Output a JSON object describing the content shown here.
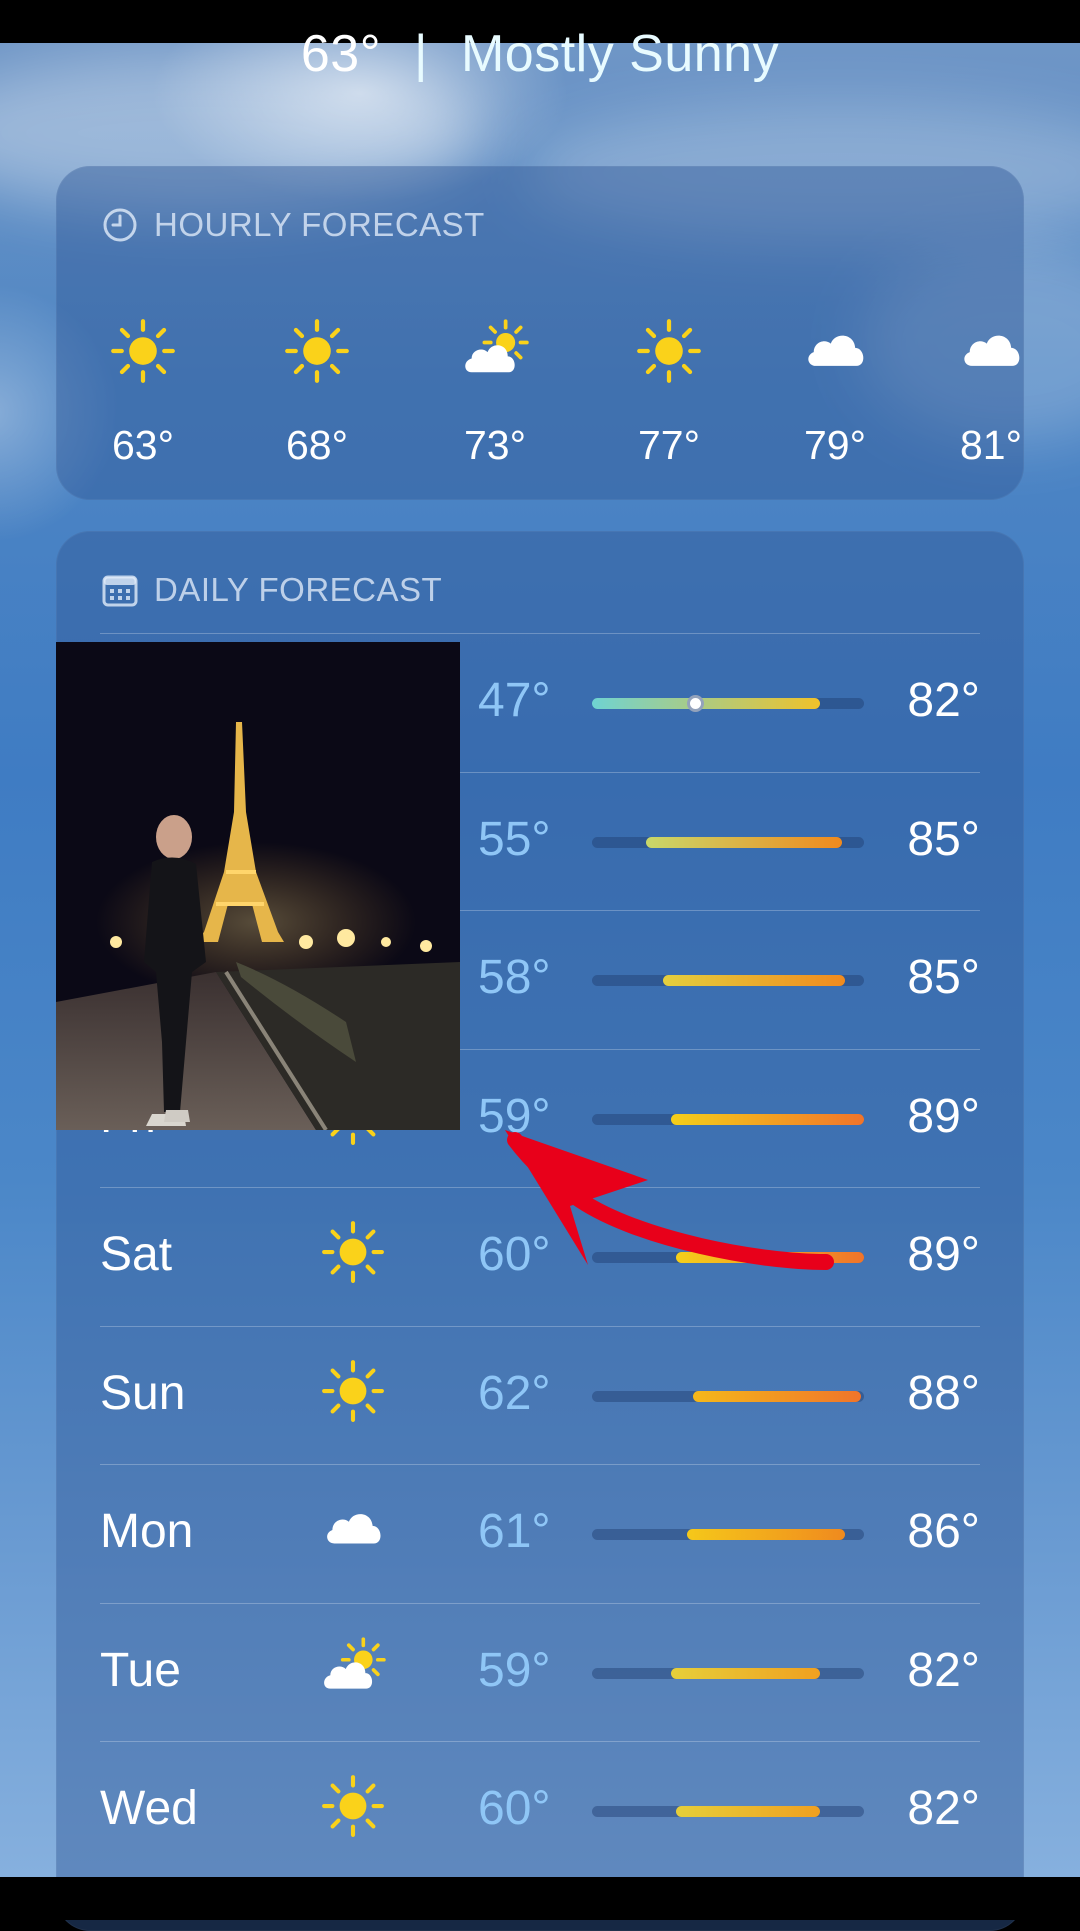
{
  "current": {
    "temp": "63°",
    "separator": "|",
    "condition": "Mostly Sunny"
  },
  "hourly": {
    "title": "HOURLY FORECAST",
    "items": [
      {
        "icon": "sun-icon",
        "temp": "63°"
      },
      {
        "icon": "sun-icon",
        "temp": "68°"
      },
      {
        "icon": "partly-cloudy-icon",
        "temp": "73°"
      },
      {
        "icon": "sun-icon",
        "temp": "77°"
      },
      {
        "icon": "cloud-icon",
        "temp": "79°"
      },
      {
        "icon": "cloud-icon",
        "temp": "81°"
      }
    ]
  },
  "daily": {
    "title": "DAILY FORECAST",
    "rows": [
      {
        "day": "",
        "icon": "",
        "low": "47°",
        "high": "82°",
        "range_start": 0.0,
        "range_end": 0.84,
        "current_marker": 0.38,
        "colors": [
          "#6fd3d2",
          "#f0c22a"
        ]
      },
      {
        "day": "",
        "icon": "",
        "low": "55°",
        "high": "85°",
        "range_start": 0.2,
        "range_end": 0.92,
        "colors": [
          "#c8d86a",
          "#f08a1e"
        ]
      },
      {
        "day": "",
        "icon": "",
        "low": "58°",
        "high": "85°",
        "range_start": 0.26,
        "range_end": 0.93,
        "colors": [
          "#e4cf3e",
          "#f08a1e"
        ]
      },
      {
        "day": "Fri",
        "icon": "sun-icon",
        "low": "59°",
        "high": "89°",
        "range_start": 0.29,
        "range_end": 1.0,
        "colors": [
          "#f5cf1a",
          "#f0742a"
        ]
      },
      {
        "day": "Sat",
        "icon": "sun-icon",
        "low": "60°",
        "high": "89°",
        "range_start": 0.31,
        "range_end": 1.0,
        "colors": [
          "#f5cf1a",
          "#f0742a"
        ]
      },
      {
        "day": "Sun",
        "icon": "sun-icon",
        "low": "62°",
        "high": "88°",
        "range_start": 0.37,
        "range_end": 0.99,
        "colors": [
          "#f5b81a",
          "#f0742a"
        ]
      },
      {
        "day": "Mon",
        "icon": "cloud-icon",
        "low": "61°",
        "high": "86°",
        "range_start": 0.35,
        "range_end": 0.93,
        "colors": [
          "#f5c81a",
          "#f08a1e"
        ]
      },
      {
        "day": "Tue",
        "icon": "partly-cloudy-icon",
        "low": "59°",
        "high": "82°",
        "range_start": 0.29,
        "range_end": 0.84,
        "colors": [
          "#e6cf3a",
          "#f0a020"
        ]
      },
      {
        "day": "Wed",
        "icon": "sun-icon",
        "low": "60°",
        "high": "82°",
        "range_start": 0.31,
        "range_end": 0.84,
        "colors": [
          "#e6cf3a",
          "#f0a020"
        ]
      }
    ]
  }
}
